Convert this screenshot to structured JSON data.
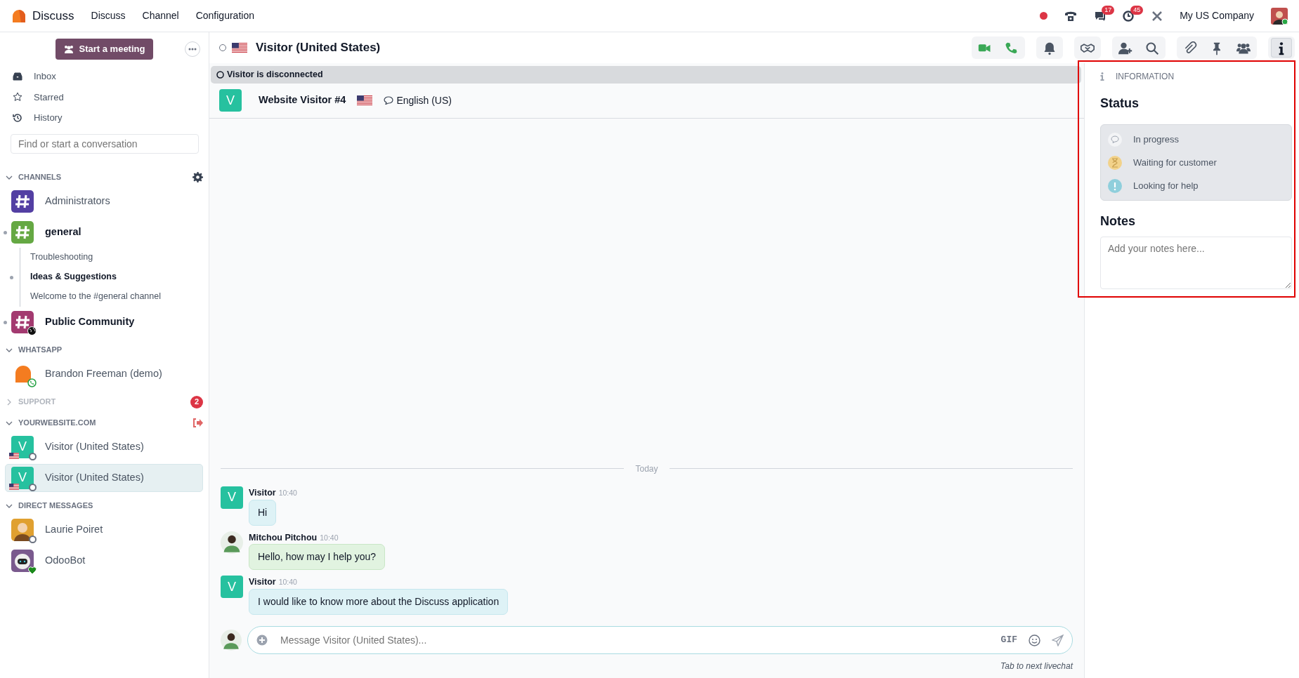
{
  "navbar": {
    "brand": "Discuss",
    "menu": [
      "Discuss",
      "Channel",
      "Configuration"
    ],
    "recording": true,
    "messages_count": "17",
    "activities_count": "45",
    "company": "My US Company"
  },
  "sidebar": {
    "start_meeting": "Start a meeting",
    "mailboxes": [
      {
        "kind": "inbox",
        "label": "Inbox"
      },
      {
        "kind": "starred",
        "label": "Starred"
      },
      {
        "kind": "history",
        "label": "History"
      }
    ],
    "search": {
      "placeholder": "Find or start a conversation"
    },
    "categories": [
      {
        "name": "CHANNELS",
        "expanded": true,
        "settings_button": true,
        "items": [
          {
            "name": "Administrators",
            "avatar": {
              "kind": "hash",
              "color": "#533fa3"
            },
            "unread": false,
            "selected": false
          },
          {
            "name": "general",
            "avatar": {
              "kind": "hash",
              "color": "#65a843"
            },
            "unread": true,
            "selected": false,
            "children": [
              {
                "name": "Troubleshooting",
                "unread": false
              },
              {
                "name": "Ideas & Suggestions",
                "unread": true
              },
              {
                "name": "Welcome to the #general channel",
                "unread": false
              }
            ]
          },
          {
            "name": "Public Community",
            "avatar": {
              "kind": "hash",
              "color": "#a33a70"
            },
            "globe_badge": true,
            "unread": true,
            "selected": false
          }
        ]
      },
      {
        "name": "WHATSAPP",
        "expanded": true,
        "items": [
          {
            "name": "Brandon Freeman (demo)",
            "avatar": {
              "kind": "logo"
            },
            "whatsapp_badge": true,
            "unread": false,
            "selected": false
          }
        ]
      },
      {
        "name": "SUPPORT",
        "expanded": false,
        "counter": "2"
      },
      {
        "name": "YOURWEBSITE.COM",
        "expanded": true,
        "leave_button": true,
        "items": [
          {
            "name": "Visitor (United States)",
            "avatar": {
              "kind": "letter",
              "text": "V",
              "color": "#26c19f"
            },
            "flag": true,
            "online": false,
            "unread": false,
            "selected": false
          },
          {
            "name": "Visitor (United States)",
            "avatar": {
              "kind": "letter",
              "text": "V",
              "color": "#26c19f"
            },
            "flag": true,
            "online": false,
            "unread": false,
            "selected": true
          }
        ]
      },
      {
        "name": "DIRECT MESSAGES",
        "expanded": true,
        "items": [
          {
            "name": "Laurie Poiret",
            "avatar": {
              "kind": "person",
              "color": "#e0a030"
            },
            "online": false,
            "unread": false,
            "selected": false
          },
          {
            "name": "OdooBot",
            "avatar": {
              "kind": "bot",
              "color": "#7a5a8e"
            },
            "online": true,
            "unread": false,
            "selected": false
          }
        ]
      }
    ]
  },
  "thread": {
    "title": "Visitor (United States)",
    "online": false,
    "flag": true,
    "toolbar": [
      {
        "buttons": [
          {
            "kind": "video",
            "selected": false
          },
          {
            "kind": "phone",
            "selected": false
          }
        ]
      },
      {
        "buttons": [
          {
            "kind": "bell",
            "selected": false
          }
        ]
      },
      {
        "buttons": [
          {
            "kind": "handshake",
            "selected": false
          }
        ]
      },
      {
        "buttons": [
          {
            "kind": "add-user",
            "selected": false
          },
          {
            "kind": "search",
            "selected": false
          }
        ]
      },
      {
        "buttons": [
          {
            "kind": "paperclip",
            "selected": false
          },
          {
            "kind": "pin",
            "selected": false
          },
          {
            "kind": "members",
            "selected": false
          }
        ]
      },
      {
        "buttons": [
          {
            "kind": "info",
            "selected": true
          }
        ]
      }
    ],
    "banner": "Visitor is disconnected",
    "visitor": {
      "avatar": "V",
      "name": "Website Visitor #4",
      "flag": true,
      "language": "English (US)"
    },
    "date": "Today",
    "messages": [
      {
        "kind": "visitor",
        "avatar": "V",
        "author": "Visitor",
        "time": "10:40",
        "text": "Hi"
      },
      {
        "kind": "agent",
        "author": "Mitchou Pitchou",
        "time": "10:40",
        "text": "Hello, how may I help you?"
      },
      {
        "kind": "visitor",
        "avatar": "V",
        "author": "Visitor",
        "time": "10:40",
        "text": "I would like to know more about the Discuss application"
      }
    ],
    "composer": {
      "placeholder": "Message Visitor (United States)...",
      "gif": "GIF",
      "hint": "Tab to next livechat"
    }
  },
  "info_panel": {
    "header": "INFORMATION",
    "status_heading": "Status",
    "statuses": [
      {
        "kind": "in_progress",
        "label": "In progress",
        "selected": false
      },
      {
        "kind": "waiting",
        "label": "Waiting for customer",
        "selected": false
      },
      {
        "kind": "help",
        "label": "Looking for help",
        "selected": false
      }
    ],
    "notes_heading": "Notes",
    "notes_placeholder": "Add your notes here..."
  }
}
